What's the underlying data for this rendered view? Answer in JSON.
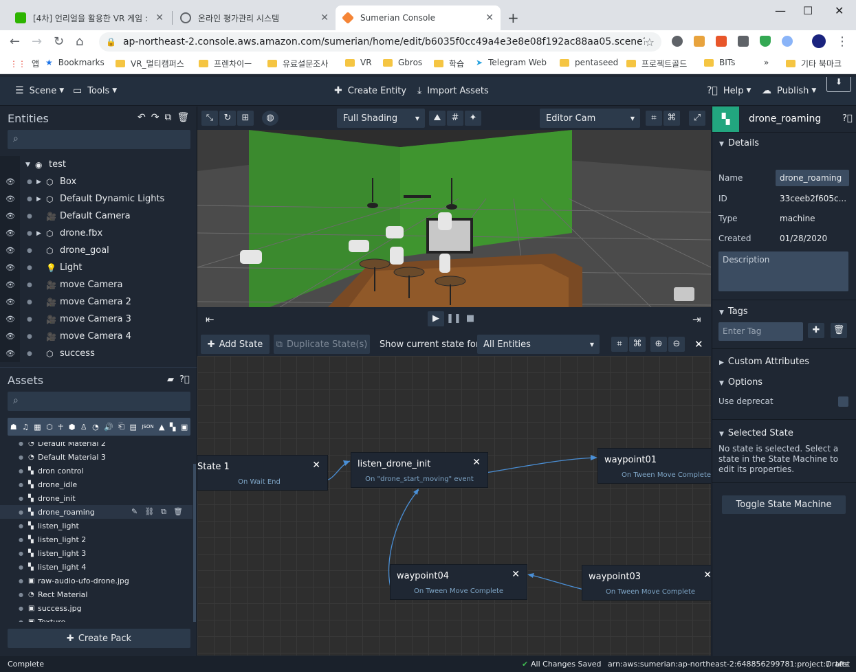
{
  "browser": {
    "tabs": [
      {
        "title": "[4차] 언리얼을 활용한 VR 게임 :",
        "favicon_color": "#2db400"
      },
      {
        "title": "온라인 평가관리 시스템",
        "favicon_color": "#5f6368"
      },
      {
        "title": "Sumerian Console",
        "favicon_color": "#f58536"
      }
    ],
    "url": "ap-northeast-2.console.aws.amazon.com/sumerian/home/edit/b6035f0cc49a4e3e8e08f192ac88aa05.scene?locale=e...",
    "bookmarks": [
      "앱",
      "Bookmarks",
      "VR_멀티캠퍼스",
      "프렌차이ㅡ",
      "유료설문조사",
      "VR",
      "Gbros",
      "학습",
      "Telegram Web",
      "pentaseed",
      "프로젝트골드",
      "BITs",
      "기타 북마크"
    ]
  },
  "appbar": {
    "scene": "Scene",
    "tools": "Tools",
    "create_entity": "Create Entity",
    "import_assets": "Import Assets",
    "help": "Help",
    "publish": "Publish"
  },
  "entities": {
    "title": "Entities",
    "root": "test",
    "items": [
      {
        "label": "Box",
        "icon": "cube-icon",
        "expandable": true
      },
      {
        "label": "Default Dynamic Lights",
        "icon": "cube-icon",
        "expandable": true
      },
      {
        "label": "Default Camera",
        "icon": "camera-icon",
        "expandable": false
      },
      {
        "label": "drone.fbx",
        "icon": "cube-icon",
        "expandable": true
      },
      {
        "label": "drone_goal",
        "icon": "cube-icon",
        "expandable": false
      },
      {
        "label": "Light",
        "icon": "bulb-icon",
        "expandable": false
      },
      {
        "label": "move Camera",
        "icon": "camera-icon",
        "expandable": false
      },
      {
        "label": "move Camera 2",
        "icon": "camera-icon",
        "expandable": false
      },
      {
        "label": "move Camera 3",
        "icon": "camera-icon",
        "expandable": false
      },
      {
        "label": "move Camera 4",
        "icon": "camera-icon",
        "expandable": false
      },
      {
        "label": "success",
        "icon": "cube-icon",
        "expandable": false
      }
    ]
  },
  "assets": {
    "title": "Assets",
    "items": [
      {
        "label": "Default Material 2",
        "icon": "material-icon"
      },
      {
        "label": "Default Material 3",
        "icon": "material-icon"
      },
      {
        "label": "dron control",
        "icon": "state-machine-icon"
      },
      {
        "label": "drone_idle",
        "icon": "state-machine-icon"
      },
      {
        "label": "drone_init",
        "icon": "state-machine-icon"
      },
      {
        "label": "drone_roaming",
        "icon": "state-machine-icon",
        "selected": true
      },
      {
        "label": "listen_light",
        "icon": "state-machine-icon"
      },
      {
        "label": "listen_light 2",
        "icon": "state-machine-icon"
      },
      {
        "label": "listen_light 3",
        "icon": "state-machine-icon"
      },
      {
        "label": "listen_light 4",
        "icon": "state-machine-icon"
      },
      {
        "label": "raw-audio-ufo-drone.jpg",
        "icon": "texture-icon"
      },
      {
        "label": "Rect Material",
        "icon": "material-icon"
      },
      {
        "label": "success.jpg",
        "icon": "texture-icon"
      },
      {
        "label": "Texture",
        "icon": "texture-icon"
      }
    ],
    "create_pack": "Create Pack"
  },
  "viewport": {
    "shading": "Full Shading",
    "camera": "Editor Cam"
  },
  "state_machine": {
    "add_state": "Add State",
    "duplicate_state": "Duplicate State(s)",
    "show_current_label": "Show current state for:",
    "show_current_value": "All Entities",
    "nodes": [
      {
        "name": "State 1",
        "event": "On Wait End"
      },
      {
        "name": "listen_drone_init",
        "event": "On \"drone_start_moving\" event"
      },
      {
        "name": "waypoint01",
        "event": "On Tween Move Complete"
      },
      {
        "name": "waypoint04",
        "event": "On Tween Move Complete"
      },
      {
        "name": "waypoint03",
        "event": "On Tween Move Complete"
      }
    ]
  },
  "inspector": {
    "title": "drone_roaming",
    "details": "Details",
    "name_label": "Name",
    "name_value": "drone_roaming",
    "id_label": "ID",
    "id_value": "33ceeb2f605c...",
    "type_label": "Type",
    "type_value": "machine",
    "created_label": "Created",
    "created_value": "01/28/2020",
    "description_placeholder": "Description",
    "tags": "Tags",
    "enter_tag": "Enter Tag",
    "custom_attributes": "Custom Attributes",
    "options": "Options",
    "use_deprecat": "Use deprecat",
    "selected_state": "Selected State",
    "selected_state_msg": "No state is selected. Select a state in the State Machine to edit its properties.",
    "toggle_button": "Toggle State Machine"
  },
  "status": {
    "left": "Complete",
    "saved": "All Changes Saved",
    "arn": "arn:aws:sumerian:ap-northeast-2:648856299781:project:Drafts",
    "sep": "/",
    "scene": "test"
  },
  "colors": {
    "accent_green": "#22a67f",
    "panel_bg": "#1f2733",
    "appbar_bg": "#232f3e",
    "edge_blue": "#4a8fd6"
  }
}
